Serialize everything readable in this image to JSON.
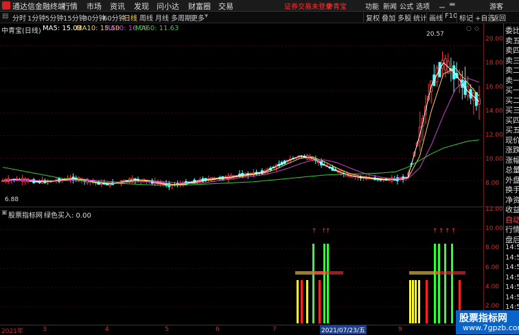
{
  "titlebar": {
    "app_name": "通达信金融终端",
    "menus": [
      "行情",
      "市场",
      "资讯",
      "发现",
      "问小达",
      "财富圈",
      "交易"
    ],
    "notice": "证券交易未登录",
    "stock": "中青宝",
    "right_menus": [
      "功能",
      "新闻",
      "公式",
      "选项"
    ],
    "guest": "游客"
  },
  "toolbar": {
    "periods": [
      "分时",
      "1分钟",
      "5分钟",
      "15分钟",
      "30分钟",
      "60分钟",
      "日线",
      "周线",
      "月线",
      "多周期",
      "更多"
    ],
    "active_period": "日线",
    "right_buttons": [
      "复权",
      "叠加",
      "多股",
      "统计",
      "画线",
      "F10",
      "标记",
      "+自选",
      "返回"
    ]
  },
  "main_chart": {
    "header": "中青宝(日线)",
    "ma_labels": [
      {
        "text": "MA5: 15.03",
        "color": "#ffffff"
      },
      {
        "text": "MA10: 15.50",
        "color": "#ffd24a"
      },
      {
        "text": "MA20: 16.08",
        "color": "#d040d0"
      },
      {
        "text": "MA60: 11.63",
        "color": "#30d030"
      }
    ],
    "y_ticks": [
      "20.00",
      "18.00",
      "16.00",
      "14.00",
      "12.00",
      "10.00",
      "8.00"
    ],
    "high_label": "20.57",
    "low_label": "6.88"
  },
  "sub_chart": {
    "header": "股票指标网",
    "indicator": "绿色买入: 0.00",
    "y_ticks": [
      "12.00",
      "10.00",
      "8.00",
      "6.00",
      "4.00",
      "2.00"
    ]
  },
  "x_axis": {
    "labels": [
      "2021年",
      "3",
      "4",
      "5",
      "6",
      "7",
      "2021/07/23/五",
      "9"
    ]
  },
  "right_panel": {
    "items": [
      "委比",
      "卖五",
      "卖四",
      "卖三",
      "卖二",
      "卖一",
      "买一",
      "买二",
      "买三",
      "买四",
      "买五",
      "现价",
      "涨跌",
      "涨幅",
      "总量",
      "外盘",
      "换手",
      "净资",
      "收益",
      "自动",
      "行情",
      "盘后",
      "14:50",
      "14:50",
      "14:50",
      "14:50",
      "14:50",
      "14:50",
      "14:50",
      "14:50"
    ]
  },
  "watermark": {
    "title": "股票指标网",
    "url": "www.7gpzb.com"
  },
  "chart_data": {
    "type": "candlestick",
    "price_range": [
      6.0,
      21.5
    ],
    "ma5": [
      8.0,
      8.1,
      8.05,
      7.9,
      7.95,
      8.1,
      8.2,
      8.0,
      7.8,
      7.7,
      7.9,
      8.1,
      8.0,
      7.8,
      7.6,
      7.7,
      7.9,
      8.1,
      8.2,
      8.3,
      8.5,
      8.6,
      8.8,
      9.3,
      9.8,
      10.2,
      10.0,
      9.4,
      8.9,
      8.5,
      8.3,
      8.2,
      8.1,
      8.1,
      8.3,
      12.0,
      16.5,
      18.5,
      17.5,
      16.0,
      15.03
    ],
    "ma60": [
      9.2,
      9.0,
      8.8,
      8.6,
      8.4,
      8.2,
      8.1,
      8.0,
      7.9,
      7.8,
      7.75,
      7.7,
      7.65,
      7.6,
      7.6,
      7.6,
      7.65,
      7.7,
      7.75,
      7.8,
      7.85,
      7.9,
      8.0,
      8.1,
      8.2,
      8.3,
      8.4,
      8.5,
      8.55,
      8.6,
      8.6,
      8.65,
      8.7,
      8.8,
      9.2,
      9.8,
      10.4,
      10.9,
      11.2,
      11.5,
      11.63
    ]
  }
}
